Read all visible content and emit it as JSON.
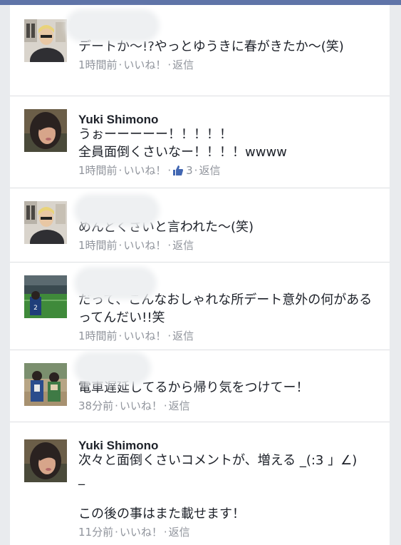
{
  "comments": [
    {
      "name": "",
      "name_blurred": true,
      "text": "デートか〜!?やっとゆうきに春がきたか〜(笑)",
      "time": "1時間前",
      "like": "いいね！",
      "reply": "返信",
      "like_count": "",
      "avatar": "avatar-man-blond"
    },
    {
      "name": "Yuki Shimono",
      "name_blurred": false,
      "text": "うぉーーーーー！！！！！\n全員面倒くさいなー！！！！wwww",
      "time": "1時間前",
      "like": "いいね！",
      "reply": "返信",
      "like_count": "3",
      "avatar": "avatar-woman-dark-hair"
    },
    {
      "name": "",
      "name_blurred": true,
      "text": "めんどくさいと言われた〜(笑)",
      "time": "1時間前",
      "like": "いいね！",
      "reply": "返信",
      "like_count": "",
      "avatar": "avatar-man-blond"
    },
    {
      "name": "",
      "name_blurred": true,
      "text": "だって、こんなおしゃれな所デート意外の何があるってんだい!!笑",
      "time": "1時間前",
      "like": "いいね！",
      "reply": "返信",
      "like_count": "",
      "avatar": "avatar-stadium"
    },
    {
      "name": "",
      "name_blurred": true,
      "text": "電車遅延してるから帰り気をつけてー！",
      "time": "38分前",
      "like": "いいね！",
      "reply": "返信",
      "like_count": "",
      "avatar": "avatar-two-people"
    },
    {
      "name": "Yuki Shimono",
      "name_blurred": false,
      "text": "次々と面倒くさいコメントが、増える _(:3 」∠)_\n\nこの後の事はまた載せます！",
      "time": "11分前",
      "like": "いいね！",
      "reply": "返信",
      "like_count": "",
      "avatar": "avatar-woman-dark-hair"
    }
  ],
  "colors": {
    "meta": "#90949c",
    "text": "#1d2129",
    "like_thumb": "#4267b2",
    "divider": "#dddfe2"
  }
}
